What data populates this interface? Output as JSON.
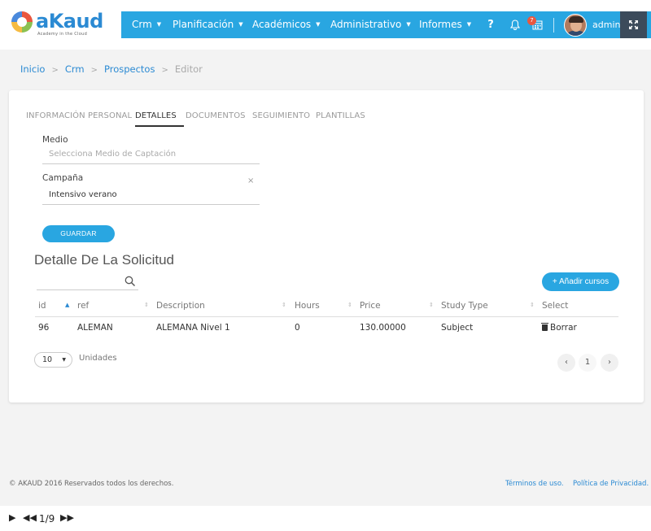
{
  "brand": {
    "name": "aKaud",
    "tagline": "Academy in the Cloud"
  },
  "nav": {
    "items": [
      {
        "label": "Crm"
      },
      {
        "label": "Planificación"
      },
      {
        "label": "Académicos"
      },
      {
        "label": "Administrativo"
      },
      {
        "label": "Informes"
      }
    ],
    "help": "?",
    "notifications_count": "7",
    "user": "admin"
  },
  "breadcrumb": {
    "items": [
      "Inicio",
      "Crm",
      "Prospectos"
    ],
    "current": "Editor"
  },
  "tabs": [
    "INFORMACIÓN PERSONAL",
    "DETALLES",
    "DOCUMENTOS",
    "SEGUIMIENTO",
    "PLANTILLAS"
  ],
  "form": {
    "medio_label": "Medio",
    "medio_placeholder": "Selecciona Medio de Captación",
    "campana_label": "Campaña",
    "campana_value": "Intensivo verano",
    "clear": "×",
    "save_label": "GUARDAR"
  },
  "detail": {
    "title": "Detalle De La Solicitud",
    "add_label": "+ Añadir cursos",
    "columns": [
      "id",
      "ref",
      "Description",
      "Hours",
      "Price",
      "Study Type",
      "Select"
    ],
    "rows": [
      {
        "id": "96",
        "ref": "ALEMAN",
        "description": "ALEMANA Nivel 1",
        "hours": "0",
        "price": "130.00000",
        "study_type": "Subject",
        "select": "Borrar"
      }
    ],
    "per_page": "10",
    "per_page_label": "Unidades",
    "page": "1",
    "prev": "‹",
    "next": "›"
  },
  "footer": {
    "copyright": "© AKAUD 2016 Reservados todos los derechos.",
    "terms": "Términos de uso.",
    "privacy": "Política de Privacidad."
  },
  "player": {
    "counter": "1/9"
  },
  "colors": {
    "accent": "#29a6e1",
    "link": "#2b8ad3",
    "dark": "#3c4b5b"
  }
}
